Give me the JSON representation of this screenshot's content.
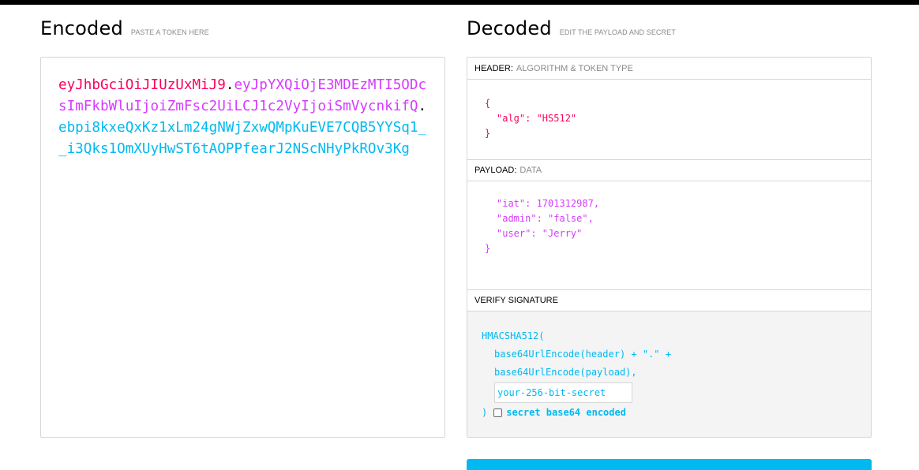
{
  "encoded": {
    "title": "Encoded",
    "subtitle": "PASTE A TOKEN HERE",
    "token": {
      "header": "eyJhbGciOiJIUzUxMiJ9",
      "dot1": ".",
      "payload": "eyJpYXQiOjE3MDEzMTI5ODcsImFkbWluIjoiZmFsc2UiLCJ1c2VyIjoiSmVycnkifQ",
      "dot2": ".",
      "signature": "ebpi8kxeQxKz1xLm24gNWjZxwQMpKuEVE7CQB5YYSq1__i3Qks1OmXUyHwST6tAOPPfearJ2NScNHyPkROv3Kg"
    }
  },
  "decoded": {
    "title": "Decoded",
    "subtitle": "EDIT THE PAYLOAD AND SECRET",
    "header_section": {
      "label": "HEADER:",
      "sublabel": "ALGORITHM & TOKEN TYPE",
      "open": "{",
      "line1": "\"alg\": \"HS512\"",
      "close": "}"
    },
    "payload_section": {
      "label": "PAYLOAD:",
      "sublabel": "DATA",
      "line1": "\"iat\": 1701312987,",
      "line2": "\"admin\": \"false\",",
      "line3": "\"user\": \"Jerry\"",
      "close": "}"
    },
    "verify_section": {
      "label": "VERIFY SIGNATURE",
      "fn_open": "HMACSHA512(",
      "line1": "base64UrlEncode(header) + \".\" +",
      "line2": "base64UrlEncode(payload),",
      "secret_placeholder": "your-256-bit-secret",
      "fn_close": ")",
      "checkbox_label": "secret base64 encoded"
    }
  },
  "colors": {
    "header": "#fb015b",
    "payload": "#d63aff",
    "signature": "#00b9f1"
  }
}
